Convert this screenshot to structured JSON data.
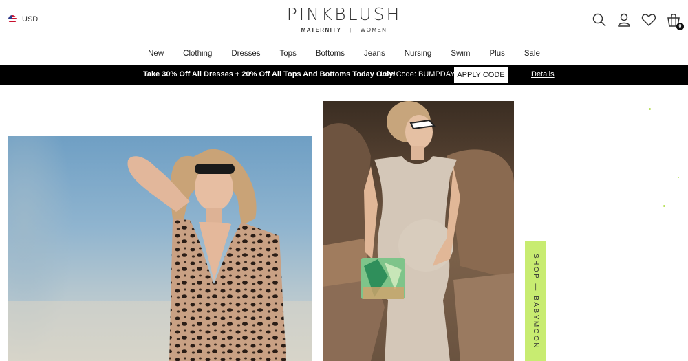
{
  "header": {
    "currency": "USD",
    "logo": {
      "main": "PINKBLUSH",
      "left": "MATERNITY",
      "sep": "|",
      "right": "WOMEN"
    },
    "icons": [
      "search-icon",
      "account-icon",
      "wishlist-icon",
      "bag-icon"
    ],
    "bag_count": "0"
  },
  "nav": {
    "items": [
      {
        "label": "New"
      },
      {
        "label": "Clothing"
      },
      {
        "label": "Dresses"
      },
      {
        "label": "Tops"
      },
      {
        "label": "Bottoms"
      },
      {
        "label": "Jeans"
      },
      {
        "label": "Nursing"
      },
      {
        "label": "Swim"
      },
      {
        "label": "Plus"
      },
      {
        "label": "Sale"
      }
    ]
  },
  "promo": {
    "text": "Take 30% Off All Dresses + 20% Off All Tops And Bottoms Today Only!",
    "code_label": "Use Code: BUMPDAY",
    "apply_button": "APPLY CODE",
    "details_link": "Details"
  },
  "side_tab": {
    "label": "SHOP — BABYMOON"
  },
  "colors": {
    "promo_bg": "#000000",
    "side_tab_bg": "#c8ec71"
  }
}
